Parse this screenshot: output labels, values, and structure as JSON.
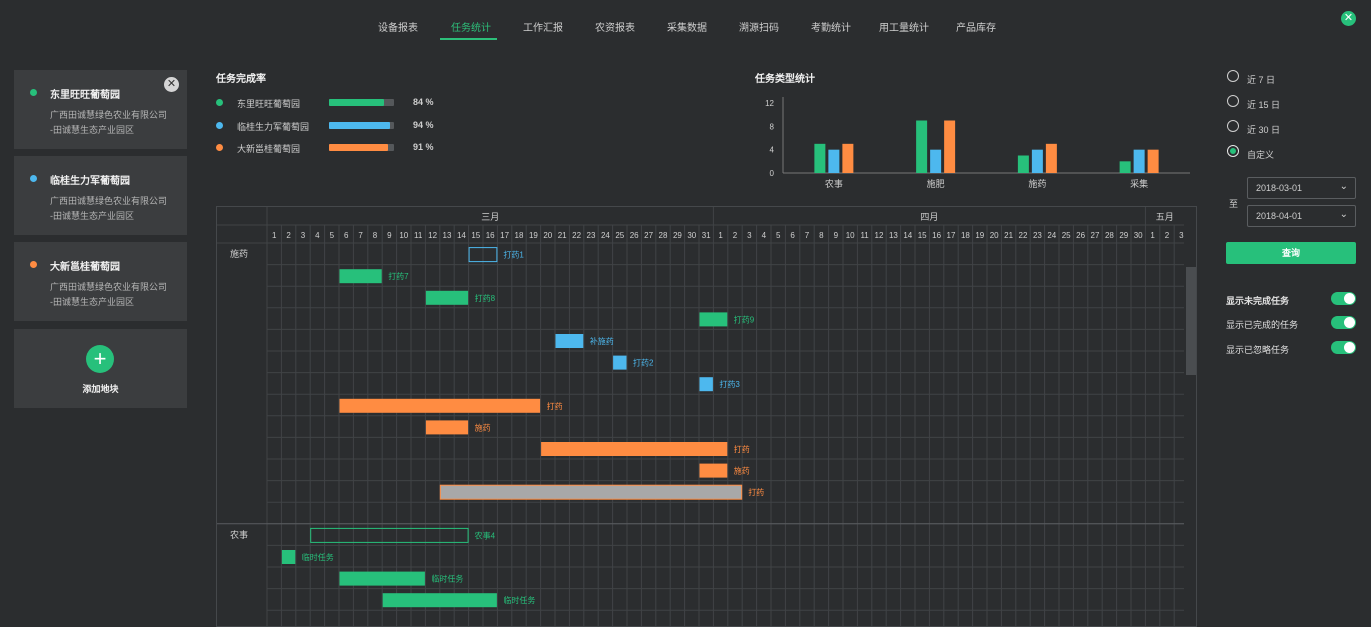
{
  "nav": {
    "items": [
      "设备报表",
      "任务统计",
      "工作汇报",
      "农资报表",
      "采集数据",
      "溯源扫码",
      "考勤统计",
      "用工量统计",
      "产品库存"
    ],
    "active": "任务统计",
    "close_icon": "✕"
  },
  "farms": [
    {
      "name": "东里旺旺葡萄园",
      "company": "广西田诚慧绿色农业有限公司",
      "park": "-田诚慧生态产业园区",
      "color": "#27c07b"
    },
    {
      "name": "临桂生力军葡萄园",
      "company": "广西田诚慧绿色农业有限公司",
      "park": "-田诚慧生态产业园区",
      "color": "#4db8ee"
    },
    {
      "name": "大新邕桂葡萄园",
      "company": "广西田诚慧绿色农业有限公司",
      "park": "-田诚慧生态产业园区",
      "color": "#ff8c42"
    }
  ],
  "add_farm": {
    "label": "添加地块",
    "icon": "+"
  },
  "completion": {
    "title": "任务完成率",
    "rows": [
      {
        "name": "东里旺旺葡萄园",
        "percent": 84,
        "color": "#27c07b"
      },
      {
        "name": "临桂生力军葡萄园",
        "percent": 94,
        "color": "#4db8ee"
      },
      {
        "name": "大新邕桂葡萄园",
        "percent": 91,
        "color": "#ff8c42"
      }
    ],
    "unit": "%"
  },
  "chart_data": {
    "type": "bar",
    "title": "任务类型统计",
    "categories": [
      "农事",
      "施肥",
      "施药",
      "采集"
    ],
    "series": [
      {
        "values": [
          5,
          9,
          3,
          2
        ],
        "color": "#27c07b"
      },
      {
        "values": [
          4,
          4,
          4,
          4
        ],
        "color": "#4db8ee"
      },
      {
        "values": [
          5,
          9,
          5,
          4
        ],
        "color": "#ff8c42"
      }
    ],
    "yticks": [
      0,
      4,
      8,
      12
    ],
    "ylim": [
      0,
      12
    ],
    "grid": false
  },
  "gantt": {
    "months": [
      {
        "label": "三月",
        "days": 31
      },
      {
        "label": "四月",
        "days": 30
      },
      {
        "label": "五月",
        "days": 3
      }
    ],
    "groups": [
      "施药",
      "农事"
    ],
    "tasks": [
      {
        "group": 0,
        "label": "打药1",
        "start": "03-15",
        "end": "03-16",
        "color": "#4db8ee",
        "style": "outline"
      },
      {
        "group": 0,
        "label": "打药7",
        "start": "03-06",
        "end": "03-08",
        "color": "#27c07b",
        "style": "fill"
      },
      {
        "group": 0,
        "label": "打药8",
        "start": "03-12",
        "end": "03-14",
        "color": "#27c07b",
        "style": "fill"
      },
      {
        "group": 0,
        "label": "打药9",
        "start": "03-31",
        "end": "04-01",
        "color": "#27c07b",
        "style": "fill"
      },
      {
        "group": 0,
        "label": "补施药",
        "start": "03-21",
        "end": "03-22",
        "color": "#4db8ee",
        "style": "fill"
      },
      {
        "group": 0,
        "label": "打药2",
        "start": "03-25",
        "end": "03-25",
        "color": "#4db8ee",
        "style": "fill"
      },
      {
        "group": 0,
        "label": "打药3",
        "start": "03-31",
        "end": "03-31",
        "color": "#4db8ee",
        "style": "fill"
      },
      {
        "group": 0,
        "label": "打药",
        "start": "03-06",
        "end": "03-19",
        "color": "#ff8c42",
        "style": "fill"
      },
      {
        "group": 0,
        "label": "施药",
        "start": "03-12",
        "end": "03-14",
        "color": "#ff8c42",
        "style": "fill"
      },
      {
        "group": 0,
        "label": "打药",
        "start": "03-20",
        "end": "04-01",
        "color": "#ff8c42",
        "style": "fill"
      },
      {
        "group": 0,
        "label": "施药",
        "start": "03-31",
        "end": "04-01",
        "color": "#ff8c42",
        "style": "fill"
      },
      {
        "group": 0,
        "label": "打药",
        "start": "03-13",
        "end": "04-02",
        "color": "#ff8c42",
        "style": "gray"
      },
      {
        "group": 1,
        "label": "农事4",
        "start": "03-04",
        "end": "03-14",
        "color": "#27c07b",
        "style": "outline"
      },
      {
        "group": 1,
        "label": "临时任务",
        "start": "03-02",
        "end": "03-02",
        "color": "#27c07b",
        "style": "fill"
      },
      {
        "group": 1,
        "label": "临时任务",
        "start": "03-06",
        "end": "03-11",
        "color": "#27c07b",
        "style": "fill"
      },
      {
        "group": 1,
        "label": "临时任务",
        "start": "03-09",
        "end": "03-16",
        "color": "#27c07b",
        "style": "fill"
      }
    ]
  },
  "filters": {
    "ranges": [
      "近 7 日",
      "近 15 日",
      "近 30 日",
      "自定义"
    ],
    "selected": 3,
    "to_label": "至",
    "start_date": "2018-03-01",
    "end_date": "2018-04-01",
    "chevron_icon": "⌄",
    "query_label": "查询",
    "toggles": [
      {
        "label": "显示未完成任务",
        "on": true
      },
      {
        "label": "显示已完成的任务",
        "on": true
      },
      {
        "label": "显示已忽略任务",
        "on": true
      }
    ]
  }
}
